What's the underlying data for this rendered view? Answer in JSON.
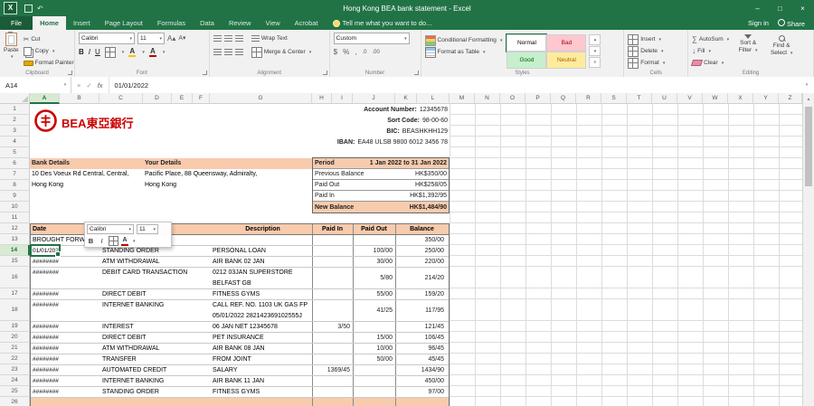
{
  "window": {
    "title": "Hong Kong BEA bank statement - Excel",
    "minimize": "–",
    "maximize": "□",
    "close": "×"
  },
  "menu": {
    "file": "File",
    "tabs": [
      "Home",
      "Insert",
      "Page Layout",
      "Formulas",
      "Data",
      "Review",
      "View",
      "Acrobat"
    ],
    "active_tab": "Home",
    "tell_me": "Tell me what you want to do...",
    "sign_in": "Sign in",
    "share": "Share"
  },
  "ribbon": {
    "clipboard": {
      "label": "Clipboard",
      "paste": "Paste",
      "cut": "Cut",
      "copy": "Copy",
      "format_painter": "Format Painter"
    },
    "font": {
      "label": "Font",
      "family": "Calibri",
      "size": "11",
      "bold": "B",
      "italic": "I",
      "underline": "U"
    },
    "alignment": {
      "label": "Alignment",
      "wrap_text": "Wrap Text",
      "merge_center": "Merge & Center"
    },
    "number": {
      "label": "Number",
      "format": "Custom",
      "currency": "$",
      "percent": "%",
      "comma": ",",
      "inc_decimal": ".0",
      "dec_decimal": ".00"
    },
    "styles": {
      "label": "Styles",
      "conditional_formatting": "Conditional Formatting",
      "format_as_table": "Format as Table",
      "cells": [
        {
          "name": "Normal",
          "bg": "#ffffff",
          "fg": "#000000"
        },
        {
          "name": "Bad",
          "bg": "#ffc7ce",
          "fg": "#9c0006"
        },
        {
          "name": "Good",
          "bg": "#c6efce",
          "fg": "#006100"
        },
        {
          "name": "Neutral",
          "bg": "#ffeb9c",
          "fg": "#9c6500"
        }
      ]
    },
    "cells": {
      "label": "Cells",
      "insert": "Insert",
      "delete": "Delete",
      "format": "Format"
    },
    "editing": {
      "label": "Editing",
      "autosum": "AutoSum",
      "fill": "Fill",
      "clear": "Clear",
      "sort_filter_1": "Sort &",
      "sort_filter_2": "Filter",
      "find_select_1": "Find &",
      "find_select_2": "Select"
    }
  },
  "formula_bar": {
    "name_box": "A14",
    "fx": "fx",
    "value": "01/01/2022"
  },
  "grid": {
    "columns": [
      "A",
      "B",
      "C",
      "D",
      "E",
      "F",
      "G",
      "H",
      "I",
      "J",
      "K",
      "L",
      "M",
      "N",
      "O",
      "P",
      "Q",
      "R",
      "S",
      "T",
      "U",
      "V",
      "W",
      "X",
      "Y",
      "Z"
    ],
    "rows": [
      "1",
      "2",
      "3",
      "4",
      "5",
      "6",
      "7",
      "8",
      "9",
      "10",
      "11",
      "12",
      "13",
      "14",
      "15",
      "16",
      "17",
      "18",
      "19",
      "20",
      "21",
      "22",
      "23",
      "24",
      "25",
      "26"
    ],
    "selected_cell": "A14"
  },
  "mini_toolbar": {
    "font": "Calibri",
    "size": "11",
    "bold": "B",
    "italic": "I"
  },
  "statement": {
    "logo": {
      "text": "BEA東亞銀行"
    },
    "account_info": [
      {
        "label": "Account Number:",
        "value": "12345678"
      },
      {
        "label": "Sort Code:",
        "value": "98-00-60"
      },
      {
        "label": "BIC:",
        "value": "BEASHKHH129"
      },
      {
        "label": "IBAN:",
        "value": "EA48 ULSB 9800 6012 3456 78"
      }
    ],
    "bank_details": {
      "header": "Bank Details",
      "line1": "10 Des Voeux Rd Central, Central,",
      "line2": "Hong Kong"
    },
    "your_details": {
      "header": "Your Details",
      "line1": "Pacific Place, 88 Queensway, Admiralty,",
      "line2": "Hong Kong"
    },
    "summary": {
      "period_label": "Period",
      "period_value": "1 Jan 2022 to 31 Jan 2022",
      "rows": [
        {
          "label": "Previous Balance",
          "value": "HK$350/00"
        },
        {
          "label": "Paid Out",
          "value": "HK$258/05"
        },
        {
          "label": "Paid In",
          "value": "HK$1,392/95"
        }
      ],
      "new_balance_label": "New Balance",
      "new_balance_value": "HK$1,484/90"
    },
    "table": {
      "headers": {
        "date": "Date",
        "description": "Description",
        "paid_in": "Paid In",
        "paid_out": "Paid Out",
        "balance": "Balance"
      },
      "brought_forward": {
        "label": "BROUGHT FORWARD",
        "balance": "350/00"
      },
      "transactions": [
        {
          "date": "01/01/2022",
          "type": "STANDING ORDER",
          "desc": [
            "PERSONAL LOAN"
          ],
          "paid_in": "",
          "paid_out": "100/00",
          "balance": "250/00",
          "selected": true
        },
        {
          "date": "########",
          "type": "ATM WITHDRAWAL",
          "desc": [
            "AIR BANK 02 JAN"
          ],
          "paid_in": "",
          "paid_out": "30/00",
          "balance": "220/00"
        },
        {
          "date": "########",
          "type": "DEBIT CARD TRANSACTION",
          "desc": [
            "0212 03JAN SUPERSTORE",
            "BELFAST GB"
          ],
          "paid_in": "",
          "paid_out": "5/80",
          "balance": "214/20"
        },
        {
          "date": "########",
          "type": "DIRECT DEBIT",
          "desc": [
            "FITNESS GYMS"
          ],
          "paid_in": "",
          "paid_out": "55/00",
          "balance": "159/20"
        },
        {
          "date": "########",
          "type": "INTERNET BANKING",
          "desc": [
            "CALL REF. NO. 1103 UK GAS FP",
            "05/01/2022 282142369102555J"
          ],
          "paid_in": "",
          "paid_out": "41/25",
          "balance": "117/95"
        },
        {
          "date": "########",
          "type": "INTEREST",
          "desc": [
            "06 JAN NET 12345678"
          ],
          "paid_in": "3/50",
          "paid_out": "",
          "balance": "121/45"
        },
        {
          "date": "########",
          "type": "DIRECT DEBIT",
          "desc": [
            "PET INSURANCE"
          ],
          "paid_in": "",
          "paid_out": "15/00",
          "balance": "106/45"
        },
        {
          "date": "########",
          "type": "ATM WITHDRAWAL",
          "desc": [
            "AIR BANK 08 JAN"
          ],
          "paid_in": "",
          "paid_out": "10/00",
          "balance": "96/45"
        },
        {
          "date": "########",
          "type": "TRANSFER",
          "desc": [
            "FROM JOINT"
          ],
          "paid_in": "",
          "paid_out": "50/00",
          "balance": "45/45"
        },
        {
          "date": "########",
          "type": "AUTOMATED CREDIT",
          "desc": [
            "SALARY"
          ],
          "paid_in": "1369/45",
          "paid_out": "",
          "balance": "1434/90"
        },
        {
          "date": "########",
          "type": "INTERNET BANKING",
          "desc": [
            "AIR BANK 11 JAN"
          ],
          "paid_in": "",
          "paid_out": "",
          "balance": "450/00"
        },
        {
          "date": "########",
          "type": "STANDING ORDER",
          "desc": [
            "FITNESS GYMS"
          ],
          "paid_in": "",
          "paid_out": "",
          "balance": "97/00"
        }
      ]
    }
  },
  "colors": {
    "accent_green": "#217346",
    "header_fill": "#f8cbad",
    "logo_red": "#cc0000",
    "selection_border": "#217346"
  }
}
